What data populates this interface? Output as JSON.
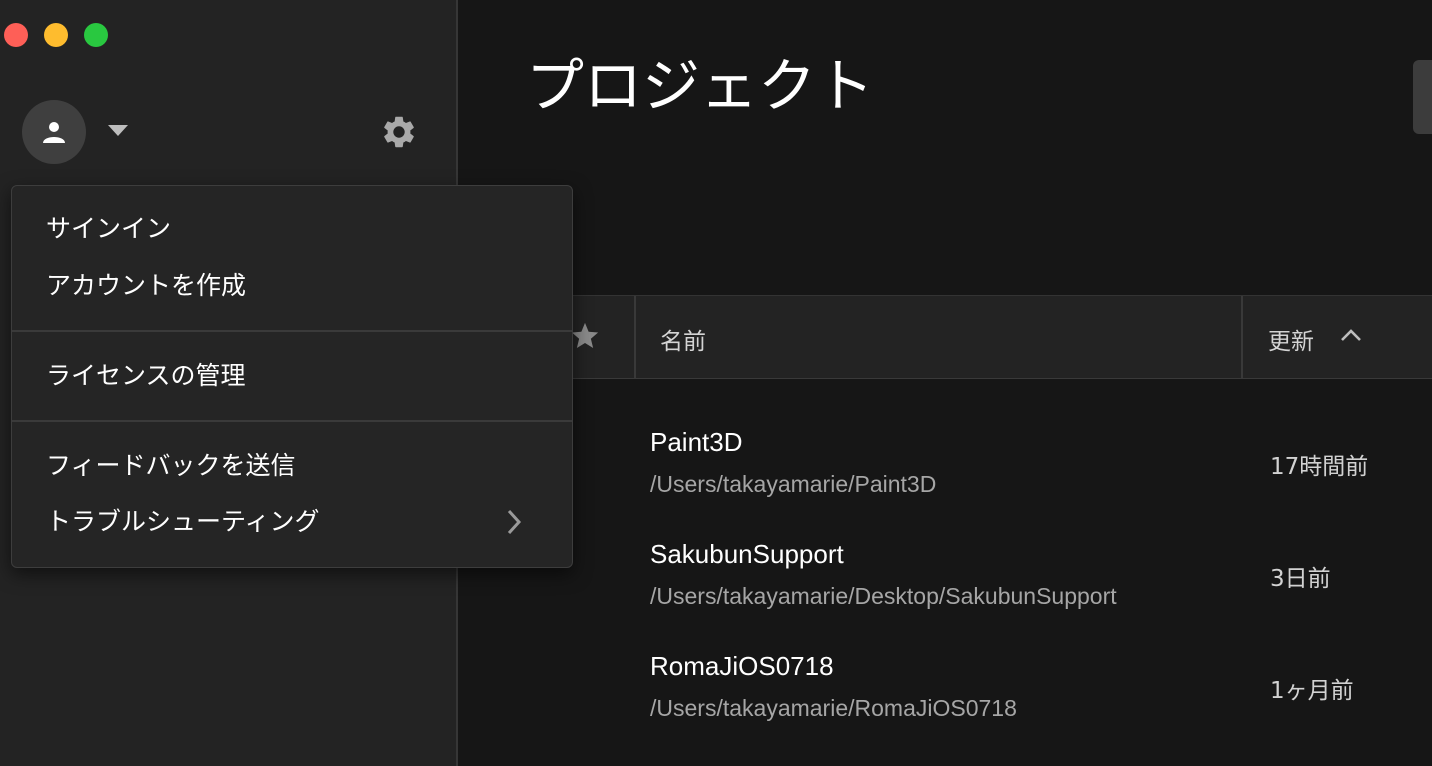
{
  "window": {
    "controls": [
      "close",
      "minimize",
      "maximize"
    ],
    "colors": {
      "close": "#fe5f57",
      "minimize": "#febc2e",
      "maximize": "#29c840"
    }
  },
  "sidebar": {
    "avatar_icon": "person-icon",
    "account_dropdown_icon": "caret-down-icon",
    "settings_icon": "gear-icon"
  },
  "account_menu": {
    "groups": [
      {
        "items": [
          {
            "label": "サインイン"
          },
          {
            "label": "アカウントを作成"
          }
        ]
      },
      {
        "items": [
          {
            "label": "ライセンスの管理"
          }
        ]
      },
      {
        "items": [
          {
            "label": "フィードバックを送信"
          },
          {
            "label": "トラブルシューティング",
            "has_submenu": true
          }
        ]
      }
    ]
  },
  "main": {
    "title": "プロジェクト",
    "table": {
      "columns": {
        "favorite_icon": "star-icon",
        "name": "名前",
        "updated": "更新",
        "sort_direction": "ascending"
      },
      "rows": [
        {
          "name": "Paint3D",
          "path": "/Users/takayamarie/Paint3D",
          "updated": "17時間前"
        },
        {
          "name": "SakubunSupport",
          "path": "/Users/takayamarie/Desktop/SakubunSupport",
          "updated": "3日前"
        },
        {
          "name": "RomaJiOS0718",
          "path": "/Users/takayamarie/RomaJiOS0718",
          "updated": "1ヶ月前"
        }
      ]
    }
  },
  "theme": {
    "background": "#161616",
    "sidebar": "#232323",
    "menu": "#252525",
    "text": "#ffffff",
    "muted_text": "#a6a6a6"
  }
}
